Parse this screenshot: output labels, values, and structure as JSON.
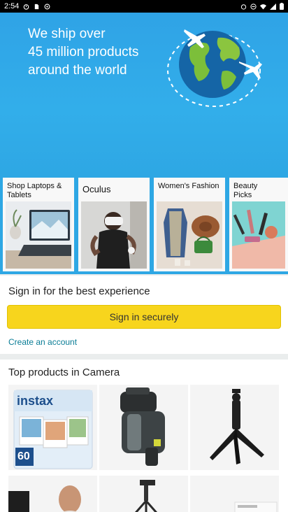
{
  "status_bar": {
    "time": "2:54"
  },
  "hero": {
    "line1": "We ship over",
    "line2": "45 million products",
    "line3": "around the world"
  },
  "category_cards": [
    {
      "label": "Shop Laptops & Tablets"
    },
    {
      "label": "Oculus"
    },
    {
      "label": "Women's Fashion"
    },
    {
      "label": "Beauty Picks"
    }
  ],
  "signin": {
    "title": "Sign in for the best experience",
    "button": "Sign in securely",
    "create_account": "Create an account"
  },
  "products": {
    "title": "Top products in Camera",
    "instax_count": "60",
    "instax_brand": "instax"
  },
  "colors": {
    "hero_blue": "#2fa3e6",
    "signin_yellow": "#f7d51d",
    "link_teal": "#0a7d96"
  }
}
